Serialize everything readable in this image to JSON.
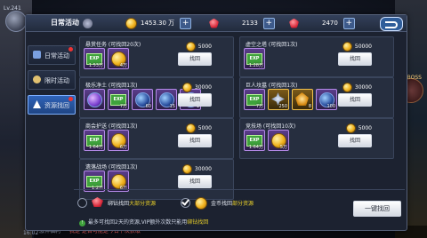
{
  "hud": {
    "level": "Lv.241",
    "chat_time": "16:02",
    "chat_text": "激神福利",
    "chat_warn": "我是 是否可能是今日下次获取",
    "boss_label": "BOSS"
  },
  "panel": {
    "title": "日常活动",
    "resources": [
      {
        "icon": "diamond-icon",
        "value": "",
        "has_plus": false
      },
      {
        "icon": "gold-coin-icon",
        "value": "1453.30 万",
        "has_plus": true
      },
      {
        "icon": "red-gem-icon",
        "value": "2133",
        "has_plus": true
      },
      {
        "icon": "ruby-icon",
        "value": "2470",
        "has_plus": true
      }
    ]
  },
  "sidebar": {
    "tabs": [
      {
        "label": "日常活动",
        "active": false,
        "badge": true
      },
      {
        "label": "限时活动",
        "active": false,
        "badge": false
      },
      {
        "label": "资源找回",
        "active": true,
        "badge": true
      }
    ]
  },
  "cards": [
    {
      "name": "悬赏任务 (可找回20次)",
      "items": [
        {
          "type": "exp",
          "count": "1.53万"
        },
        {
          "type": "coin",
          "count": "4万"
        }
      ],
      "price": "5000",
      "button": "找回"
    },
    {
      "name": "虚空之塔 (可找回1次)",
      "items": [
        {
          "type": "exp",
          "count": "1.28万"
        }
      ],
      "price": "50000",
      "button": "找回"
    },
    {
      "name": "极乐净土 (可找回1次)",
      "items": [
        {
          "type": "orb-purple",
          "count": ""
        },
        {
          "type": "exp",
          "count": "7万"
        },
        {
          "type": "orb-blue",
          "count": "60"
        },
        {
          "type": "orb-blue",
          "count": "15"
        },
        {
          "type": "orb-pink",
          "count": "1"
        }
      ],
      "price": "30000",
      "button": "找回"
    },
    {
      "name": "巨人坟墓 (可找回1次)",
      "items": [
        {
          "type": "exp",
          "count": "7万"
        },
        {
          "type": "gear",
          "count": "250"
        },
        {
          "type": "gold",
          "count": "8"
        },
        {
          "type": "orb-blue",
          "count": "100"
        }
      ],
      "price": "30000",
      "button": "找回"
    },
    {
      "name": "商会护送 (可找回1次)",
      "items": [
        {
          "type": "exp",
          "count": "1.64万"
        },
        {
          "type": "coin",
          "count": "6万"
        }
      ],
      "price": "5000",
      "button": "找回"
    },
    {
      "name": "竞技场 (可找回10次)",
      "items": [
        {
          "type": "exp",
          "count": "1.64万"
        },
        {
          "type": "coin",
          "count": "5万"
        }
      ],
      "price": "5000",
      "button": "找回"
    },
    {
      "name": "遗落战场 (可找回1次)",
      "items": [
        {
          "type": "exp",
          "count": "1.2万"
        },
        {
          "type": "coin",
          "count": "6万"
        }
      ],
      "price": "30000",
      "button": "找回"
    }
  ],
  "bottom": {
    "option1_prefix": "绑钻找回",
    "option1_hl": "大部分资源",
    "option2_prefix": "金币找回",
    "option2_hl": "部分资源",
    "note_prefix": "最多可找回2天的资源,VIP额外次数只能用",
    "note_hl": "绑钻找回",
    "onekey_label": "一键找回"
  }
}
